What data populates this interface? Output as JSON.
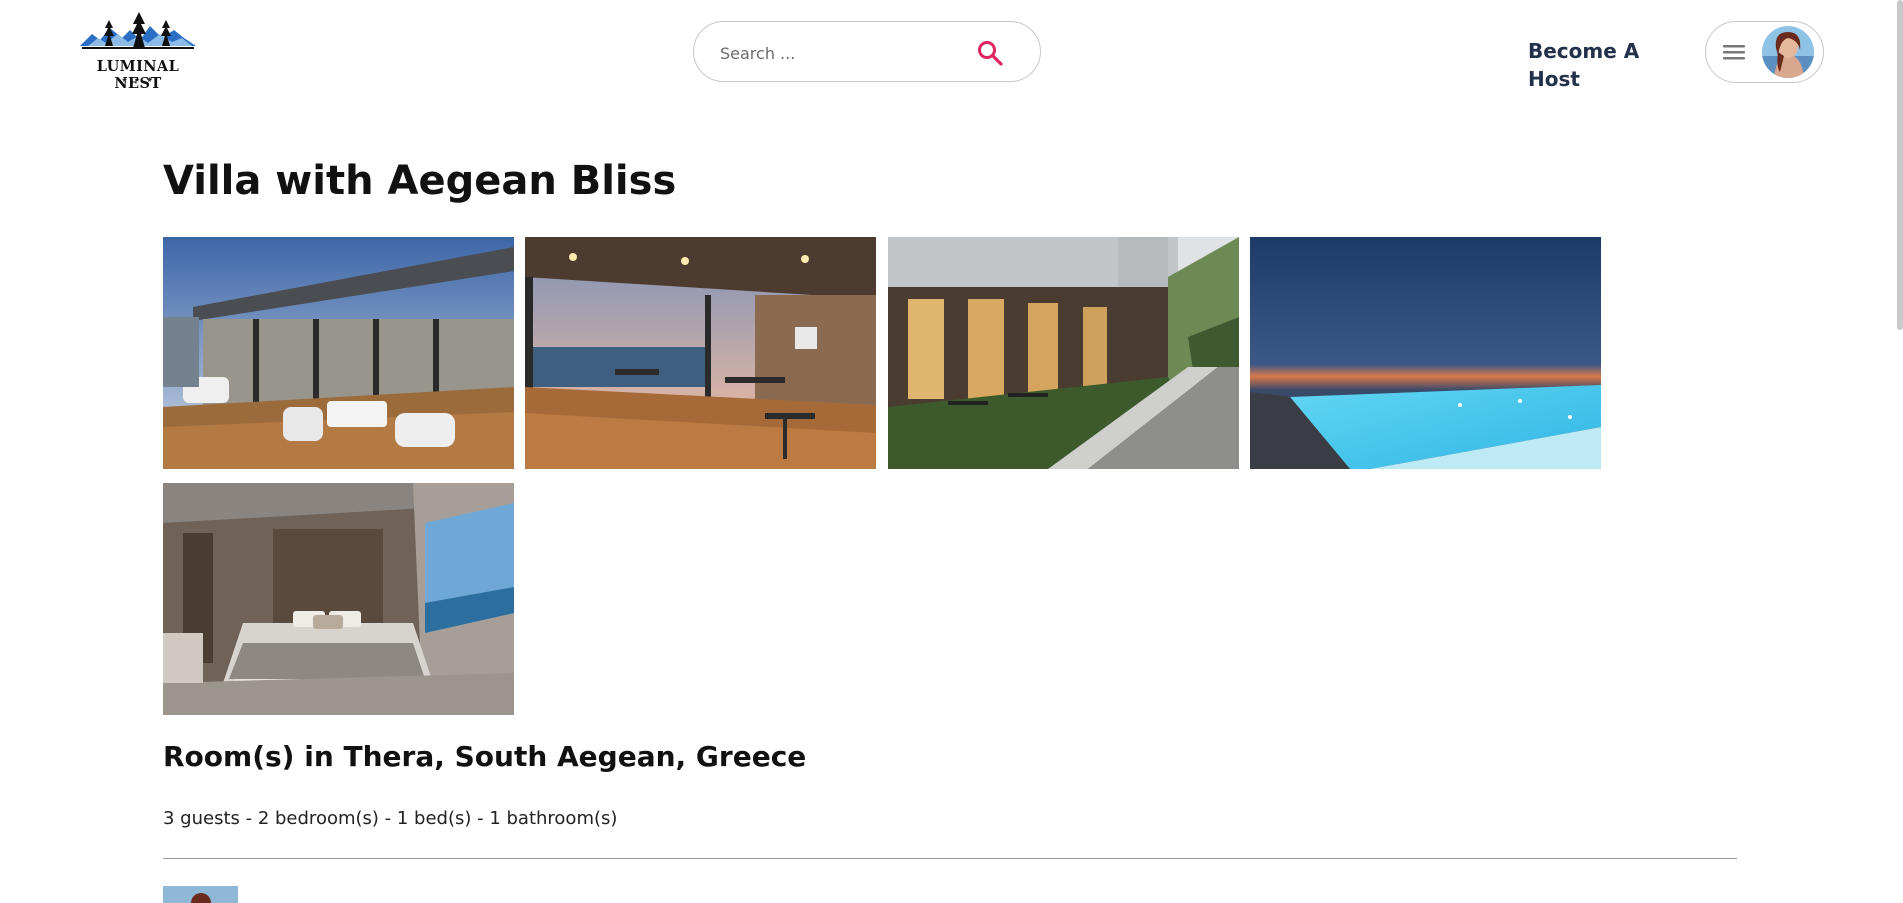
{
  "brand": {
    "name": "LUMINAL NEST",
    "stars": "★ ★ ★",
    "accent_color": "#e0245e",
    "nav_text_color": "#23314a"
  },
  "header": {
    "search": {
      "placeholder": "Search ...",
      "value": "",
      "icon": "search-icon"
    },
    "become_host_label": "Become A Host",
    "user_menu": {
      "menu_icon": "hamburger-icon",
      "avatar_icon": "user-avatar"
    }
  },
  "listing": {
    "title": "Villa with Aegean Bliss",
    "photos": [
      {
        "alt": "Rooftop terrace lounge at dusk"
      },
      {
        "alt": "Covered wooden deck restaurant by the sea"
      },
      {
        "alt": "Hotel facade with garden terrace"
      },
      {
        "alt": "Infinity pool at twilight"
      },
      {
        "alt": "Bedroom with sea view window"
      }
    ],
    "location_title": "Room(s) in Thera, South Aegean, Greece",
    "summary": "3 guests - 2 bedroom(s) - 1 bed(s) - 1 bathroom(s)"
  }
}
